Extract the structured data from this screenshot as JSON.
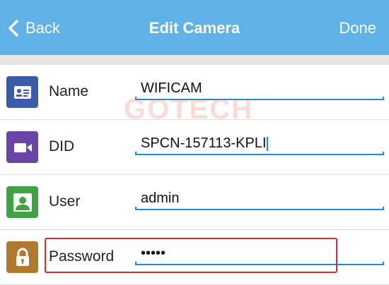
{
  "header": {
    "back_label": "Back",
    "title": "Edit Camera",
    "done_label": "Done",
    "background": "#5fb2e5"
  },
  "watermark": "GOTECH",
  "fields": [
    {
      "label": "Name",
      "value": "WIFICAM",
      "icon": "contact-card-icon",
      "icon_color": "#3a5ba8"
    },
    {
      "label": "DID",
      "value": "SPCN-157113-KPLI",
      "icon": "video-camera-icon",
      "icon_color": "#6a45a8"
    },
    {
      "label": "User",
      "value": "admin",
      "icon": "user-icon",
      "icon_color": "#3fa345"
    },
    {
      "label": "Password",
      "value": "•••••",
      "icon": "lock-icon",
      "icon_color": "#b07a2e"
    }
  ],
  "highlight_color": "#d32f2f",
  "accent": "#1f8ad6"
}
